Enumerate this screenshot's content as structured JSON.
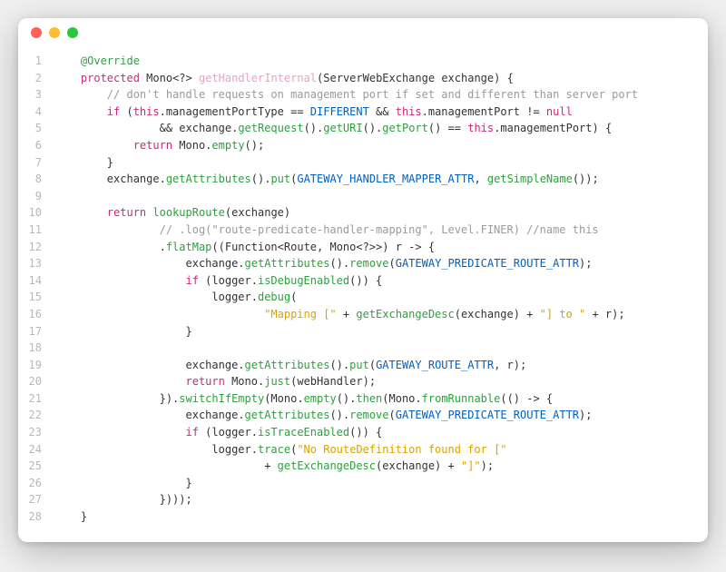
{
  "colors": {
    "window_bg": "#ffffff",
    "titlebar_red": "#ff5f57",
    "titlebar_yellow": "#febc2e",
    "titlebar_green": "#28c840",
    "gutter": "#b8b8b8",
    "keyword": "#c92a7a",
    "method_decl": "#e6a2c6",
    "call": "#2f9f3f",
    "constant": "#0060c0",
    "comment": "#9b9b9b",
    "string": "#d9a400",
    "plain": "#333333"
  },
  "lines": [
    {
      "n": 1,
      "tokens": [
        {
          "t": "    ",
          "c": "pun"
        },
        {
          "t": "@Override",
          "c": "fn"
        }
      ]
    },
    {
      "n": 2,
      "tokens": [
        {
          "t": "    ",
          "c": "pun"
        },
        {
          "t": "protected",
          "c": "kw"
        },
        {
          "t": " ",
          "c": "pun"
        },
        {
          "t": "Mono",
          "c": "typ"
        },
        {
          "t": "<?> ",
          "c": "pun"
        },
        {
          "t": "getHandlerInternal",
          "c": "mth"
        },
        {
          "t": "(",
          "c": "pun"
        },
        {
          "t": "ServerWebExchange",
          "c": "typ"
        },
        {
          "t": " exchange) {",
          "c": "pun"
        }
      ]
    },
    {
      "n": 3,
      "tokens": [
        {
          "t": "        ",
          "c": "pun"
        },
        {
          "t": "// don't handle requests on management port if set and different than server port",
          "c": "cmt"
        }
      ]
    },
    {
      "n": 4,
      "tokens": [
        {
          "t": "        ",
          "c": "pun"
        },
        {
          "t": "if",
          "c": "ctl"
        },
        {
          "t": " (",
          "c": "pun"
        },
        {
          "t": "this",
          "c": "kw"
        },
        {
          "t": ".managementPortType == ",
          "c": "id"
        },
        {
          "t": "DIFFERENT",
          "c": "cst"
        },
        {
          "t": " && ",
          "c": "op"
        },
        {
          "t": "this",
          "c": "kw"
        },
        {
          "t": ".managementPort != ",
          "c": "id"
        },
        {
          "t": "null",
          "c": "kw"
        }
      ]
    },
    {
      "n": 5,
      "tokens": [
        {
          "t": "                ",
          "c": "pun"
        },
        {
          "t": "&& ",
          "c": "op"
        },
        {
          "t": "exchange.",
          "c": "id"
        },
        {
          "t": "getRequest",
          "c": "fn"
        },
        {
          "t": "().",
          "c": "pun"
        },
        {
          "t": "getURI",
          "c": "fn"
        },
        {
          "t": "().",
          "c": "pun"
        },
        {
          "t": "getPort",
          "c": "fn"
        },
        {
          "t": "() == ",
          "c": "pun"
        },
        {
          "t": "this",
          "c": "kw"
        },
        {
          "t": ".managementPort) {",
          "c": "id"
        }
      ]
    },
    {
      "n": 6,
      "tokens": [
        {
          "t": "            ",
          "c": "pun"
        },
        {
          "t": "return",
          "c": "kw"
        },
        {
          "t": " Mono.",
          "c": "id"
        },
        {
          "t": "empty",
          "c": "fn"
        },
        {
          "t": "();",
          "c": "pun"
        }
      ]
    },
    {
      "n": 7,
      "tokens": [
        {
          "t": "        }",
          "c": "pun"
        }
      ]
    },
    {
      "n": 8,
      "tokens": [
        {
          "t": "        ",
          "c": "pun"
        },
        {
          "t": "exchange.",
          "c": "id"
        },
        {
          "t": "getAttributes",
          "c": "fn"
        },
        {
          "t": "().",
          "c": "pun"
        },
        {
          "t": "put",
          "c": "fn"
        },
        {
          "t": "(",
          "c": "pun"
        },
        {
          "t": "GATEWAY_HANDLER_MAPPER_ATTR",
          "c": "cst"
        },
        {
          "t": ", ",
          "c": "pun"
        },
        {
          "t": "getSimpleName",
          "c": "fn"
        },
        {
          "t": "());",
          "c": "pun"
        }
      ]
    },
    {
      "n": 9,
      "tokens": [
        {
          "t": " ",
          "c": "pun"
        }
      ]
    },
    {
      "n": 10,
      "tokens": [
        {
          "t": "        ",
          "c": "pun"
        },
        {
          "t": "return",
          "c": "kw"
        },
        {
          "t": " ",
          "c": "pun"
        },
        {
          "t": "lookupRoute",
          "c": "fn"
        },
        {
          "t": "(exchange)",
          "c": "pun"
        }
      ]
    },
    {
      "n": 11,
      "tokens": [
        {
          "t": "                ",
          "c": "pun"
        },
        {
          "t": "// .log(\"route-predicate-handler-mapping\", Level.FINER) //name this",
          "c": "cmt"
        }
      ]
    },
    {
      "n": 12,
      "tokens": [
        {
          "t": "                .",
          "c": "pun"
        },
        {
          "t": "flatMap",
          "c": "fn"
        },
        {
          "t": "((",
          "c": "pun"
        },
        {
          "t": "Function",
          "c": "typ"
        },
        {
          "t": "<",
          "c": "pun"
        },
        {
          "t": "Route",
          "c": "typ"
        },
        {
          "t": ", ",
          "c": "pun"
        },
        {
          "t": "Mono",
          "c": "typ"
        },
        {
          "t": "<?>>) r -> {",
          "c": "pun"
        }
      ]
    },
    {
      "n": 13,
      "tokens": [
        {
          "t": "                    ",
          "c": "pun"
        },
        {
          "t": "exchange.",
          "c": "id"
        },
        {
          "t": "getAttributes",
          "c": "fn"
        },
        {
          "t": "().",
          "c": "pun"
        },
        {
          "t": "remove",
          "c": "fn"
        },
        {
          "t": "(",
          "c": "pun"
        },
        {
          "t": "GATEWAY_PREDICATE_ROUTE_ATTR",
          "c": "cst"
        },
        {
          "t": ");",
          "c": "pun"
        }
      ]
    },
    {
      "n": 14,
      "tokens": [
        {
          "t": "                    ",
          "c": "pun"
        },
        {
          "t": "if",
          "c": "ctl"
        },
        {
          "t": " (logger.",
          "c": "id"
        },
        {
          "t": "isDebugEnabled",
          "c": "fn"
        },
        {
          "t": "()) {",
          "c": "pun"
        }
      ]
    },
    {
      "n": 15,
      "tokens": [
        {
          "t": "                        ",
          "c": "pun"
        },
        {
          "t": "logger.",
          "c": "id"
        },
        {
          "t": "debug",
          "c": "fn"
        },
        {
          "t": "(",
          "c": "pun"
        }
      ]
    },
    {
      "n": 16,
      "tokens": [
        {
          "t": "                                ",
          "c": "pun"
        },
        {
          "t": "\"Mapping [\"",
          "c": "str"
        },
        {
          "t": " + ",
          "c": "op"
        },
        {
          "t": "getExchangeDesc",
          "c": "fn"
        },
        {
          "t": "(exchange) + ",
          "c": "pun"
        },
        {
          "t": "\"] to \"",
          "c": "str"
        },
        {
          "t": " + r);",
          "c": "pun"
        }
      ]
    },
    {
      "n": 17,
      "tokens": [
        {
          "t": "                    }",
          "c": "pun"
        }
      ]
    },
    {
      "n": 18,
      "tokens": [
        {
          "t": " ",
          "c": "pun"
        }
      ]
    },
    {
      "n": 19,
      "tokens": [
        {
          "t": "                    ",
          "c": "pun"
        },
        {
          "t": "exchange.",
          "c": "id"
        },
        {
          "t": "getAttributes",
          "c": "fn"
        },
        {
          "t": "().",
          "c": "pun"
        },
        {
          "t": "put",
          "c": "fn"
        },
        {
          "t": "(",
          "c": "pun"
        },
        {
          "t": "GATEWAY_ROUTE_ATTR",
          "c": "cst"
        },
        {
          "t": ", r);",
          "c": "pun"
        }
      ]
    },
    {
      "n": 20,
      "tokens": [
        {
          "t": "                    ",
          "c": "pun"
        },
        {
          "t": "return",
          "c": "kw"
        },
        {
          "t": " Mono.",
          "c": "id"
        },
        {
          "t": "just",
          "c": "fn"
        },
        {
          "t": "(webHandler);",
          "c": "pun"
        }
      ]
    },
    {
      "n": 21,
      "tokens": [
        {
          "t": "                }).",
          "c": "pun"
        },
        {
          "t": "switchIfEmpty",
          "c": "fn"
        },
        {
          "t": "(Mono.",
          "c": "id"
        },
        {
          "t": "empty",
          "c": "fn"
        },
        {
          "t": "().",
          "c": "pun"
        },
        {
          "t": "then",
          "c": "fn"
        },
        {
          "t": "(Mono.",
          "c": "id"
        },
        {
          "t": "fromRunnable",
          "c": "fn"
        },
        {
          "t": "(() -> {",
          "c": "pun"
        }
      ]
    },
    {
      "n": 22,
      "tokens": [
        {
          "t": "                    ",
          "c": "pun"
        },
        {
          "t": "exchange.",
          "c": "id"
        },
        {
          "t": "getAttributes",
          "c": "fn"
        },
        {
          "t": "().",
          "c": "pun"
        },
        {
          "t": "remove",
          "c": "fn"
        },
        {
          "t": "(",
          "c": "pun"
        },
        {
          "t": "GATEWAY_PREDICATE_ROUTE_ATTR",
          "c": "cst"
        },
        {
          "t": ");",
          "c": "pun"
        }
      ]
    },
    {
      "n": 23,
      "tokens": [
        {
          "t": "                    ",
          "c": "pun"
        },
        {
          "t": "if",
          "c": "ctl"
        },
        {
          "t": " (logger.",
          "c": "id"
        },
        {
          "t": "isTraceEnabled",
          "c": "fn"
        },
        {
          "t": "()) {",
          "c": "pun"
        }
      ]
    },
    {
      "n": 24,
      "tokens": [
        {
          "t": "                        ",
          "c": "pun"
        },
        {
          "t": "logger.",
          "c": "id"
        },
        {
          "t": "trace",
          "c": "fn"
        },
        {
          "t": "(",
          "c": "pun"
        },
        {
          "t": "\"No RouteDefinition found for [\"",
          "c": "str"
        }
      ]
    },
    {
      "n": 25,
      "tokens": [
        {
          "t": "                                + ",
          "c": "pun"
        },
        {
          "t": "getExchangeDesc",
          "c": "fn"
        },
        {
          "t": "(exchange) + ",
          "c": "pun"
        },
        {
          "t": "\"]\"",
          "c": "str"
        },
        {
          "t": ");",
          "c": "pun"
        }
      ]
    },
    {
      "n": 26,
      "tokens": [
        {
          "t": "                    }",
          "c": "pun"
        }
      ]
    },
    {
      "n": 27,
      "tokens": [
        {
          "t": "                })));",
          "c": "pun"
        }
      ]
    },
    {
      "n": 28,
      "tokens": [
        {
          "t": "    }",
          "c": "pun"
        }
      ]
    }
  ]
}
